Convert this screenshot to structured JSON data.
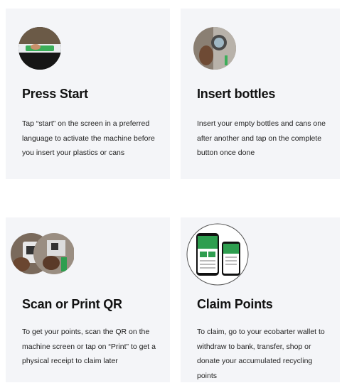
{
  "steps": [
    {
      "title": "Press Start",
      "description": "Tap “start” on the screen in a preferred language to activate the machine before you insert your plastics or cans",
      "image_icon": "press-start-photo"
    },
    {
      "title": "Insert bottles",
      "description": "Insert your empty bottles and cans one after another and tap on the complete button once done",
      "image_icon": "insert-bottle-photo"
    },
    {
      "title": "Scan or Print QR",
      "description": "To get your points, scan the QR on the machine screen or tap on “Print” to get a physical receipt to claim later",
      "image_icon": "scan-qr-photo"
    },
    {
      "title": "Claim Points",
      "description": "To claim, go to your ecobarter wallet to withdraw to bank, transfer, shop or donate your accumulated recycling points",
      "image_icon": "wallet-app-phones"
    }
  ],
  "colors": {
    "card_background": "#f4f5f8",
    "app_green": "#2e9e4f"
  }
}
